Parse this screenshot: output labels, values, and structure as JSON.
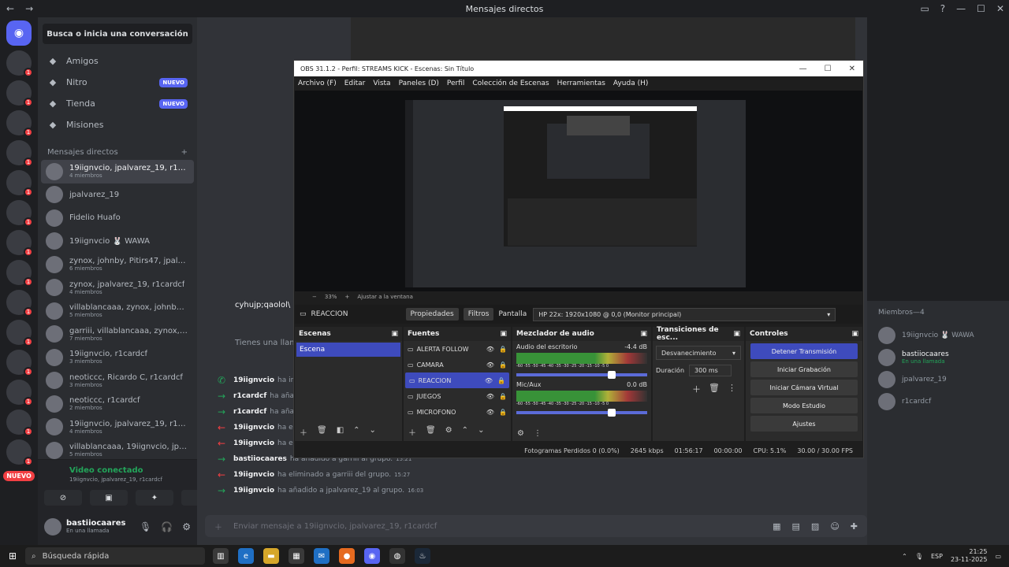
{
  "window": {
    "title": "Mensajes directos"
  },
  "servers": {
    "nuevo_label": "NUEVO",
    "badges": [
      "1",
      "1",
      "1",
      "1",
      "1",
      "1",
      "1",
      "1",
      "1",
      "1",
      "1",
      "1",
      "1",
      "1"
    ]
  },
  "dm_sidebar": {
    "search_label": "Busca o inicia una conversación",
    "nav": [
      {
        "label": "Amigos",
        "icon": "friends-icon"
      },
      {
        "label": "Nitro",
        "icon": "nitro-icon",
        "pill": "NUEVO"
      },
      {
        "label": "Tienda",
        "icon": "store-icon",
        "pill": "NUEVO"
      },
      {
        "label": "Misiones",
        "icon": "quests-icon"
      }
    ],
    "dm_header": "Mensajes directos",
    "add_label": "+",
    "dms": [
      {
        "name": "19iignvcio, jpalvarez_19, r1car...",
        "sub": "4 miembros"
      },
      {
        "name": "jpalvarez_19",
        "sub": ""
      },
      {
        "name": "Fidelio Huafo",
        "sub": ""
      },
      {
        "name": "19iignvcio 🐰 WAWA",
        "sub": ""
      },
      {
        "name": "zynox, johnby, Pitirs47, jpalvar...",
        "sub": "6 miembros"
      },
      {
        "name": "zynox, jpalvarez_19, r1cardcf",
        "sub": "4 miembros"
      },
      {
        "name": "villablancaaa, zynox, johnby, j...",
        "sub": "5 miembros"
      },
      {
        "name": "garriii, villablancaaa, zynox, jo...",
        "sub": "7 miembros"
      },
      {
        "name": "19iignvcio, r1cardcf",
        "sub": "3 miembros"
      },
      {
        "name": "neoticcc, Ricardo C, r1cardcf",
        "sub": "3 miembros"
      },
      {
        "name": "neoticcc, r1cardcf",
        "sub": "2 miembros"
      },
      {
        "name": "19iignvcio, jpalvarez_19, r1car...",
        "sub": "4 miembros"
      },
      {
        "name": "villablancaaa, 19iignvcio, jpalv...",
        "sub": "5 miembros"
      }
    ]
  },
  "voice": {
    "status": "Video conectado",
    "channel": "19iignvcio, jpalvarez_19, r1cardcf"
  },
  "user": {
    "name": "bastiiocaares",
    "status": "En una llamada"
  },
  "chat": {
    "top_name": "cyhujp;qaolol\\",
    "call_text": "Tienes una llamad",
    "messages": [
      {
        "icon": "phone-icon",
        "user": "19iignvcio",
        "text": "ha inic",
        "time": ""
      },
      {
        "icon": "arrow-right-icon",
        "user": "r1cardcf",
        "text": "ha aña",
        "time": ""
      },
      {
        "icon": "arrow-right-icon",
        "user": "r1cardcf",
        "text": "ha aña",
        "time": ""
      },
      {
        "icon": "arrow-left-icon",
        "user": "19iignvcio",
        "text": "ha elim",
        "time": ""
      },
      {
        "icon": "arrow-left-icon",
        "user": "19iignvcio",
        "text": "ha elim",
        "time": ""
      },
      {
        "icon": "arrow-right-icon",
        "user": "bastiiocaares",
        "text": "ha añadido a garriii al grupo.",
        "time": "15:21"
      },
      {
        "icon": "arrow-left-icon",
        "user": "19iignvcio",
        "text": "ha eliminado a garriii del grupo.",
        "time": "15:27"
      },
      {
        "icon": "arrow-right-icon",
        "user": "19iignvcio",
        "text": "ha añadido a jpalvarez_19 al grupo.",
        "time": "16:03"
      }
    ],
    "composer_placeholder": "Enviar mensaje a 19iignvcio, jpalvarez_19, r1cardcf"
  },
  "members": {
    "header": "Miembros—4",
    "list": [
      {
        "name": "19iignvcio 🐰 WAWA",
        "status": "",
        "online": false
      },
      {
        "name": "bastiiocaares",
        "status": "En una llamada",
        "online": true
      },
      {
        "name": "jpalvarez_19",
        "status": "",
        "online": false
      },
      {
        "name": "r1cardcf",
        "status": "",
        "online": false
      }
    ]
  },
  "obs": {
    "title": "OBS 31.1.2 - Perfil: STREAMS KICK - Escenas: Sin Título",
    "menu": [
      "Archivo (F)",
      "Editar",
      "Vista",
      "Paneles (D)",
      "Perfil",
      "Colección de Escenas",
      "Herramientas",
      "Ayuda (H)"
    ],
    "zoom": "33%",
    "fit": "Ajustar a la ventana",
    "source_name": "REACCION",
    "properties": "Propiedades",
    "filters": "Filtros",
    "screen_label": "Pantalla",
    "screen_value": "HP 22x: 1920x1080 @ 0,0 (Monitor principal)",
    "scenes_title": "Escenas",
    "scenes": [
      "Escena"
    ],
    "sources_title": "Fuentes",
    "sources": [
      "ALERTA FOLLOW",
      "CAMARA",
      "REACCION",
      "JUEGOS",
      "MICROFONO"
    ],
    "mixer_title": "Mezclador de audio",
    "mixer": [
      {
        "name": "Audio del escritorio",
        "db": "-4.4 dB"
      },
      {
        "name": "Mic/Aux",
        "db": "0.0 dB"
      }
    ],
    "meter_ticks": "-60 -55 -50 -45 -40 -35 -30 -25 -20 -15 -10 -5 0",
    "transitions_title": "Transiciones de esc...",
    "transition": "Desvanecimiento",
    "duration_label": "Duración",
    "duration_value": "300 ms",
    "controls_title": "Controles",
    "controls": [
      "Detener Transmisión",
      "Iniciar Grabación",
      "Iniciar Cámara Virtual",
      "Modo Estudio",
      "Ajustes"
    ],
    "status": {
      "dropped": "Fotogramas Perdidos 0 (0.0%)",
      "kbps": "2645 kbps",
      "live": "01:56:17",
      "rec": "00:00:00",
      "cpu": "CPU: 5.1%",
      "fps": "30.00 / 30.00 FPS"
    }
  },
  "taskbar": {
    "search": "Búsqueda rápida",
    "lang": "ESP",
    "time": "21:25",
    "date": "23-11-2025"
  }
}
